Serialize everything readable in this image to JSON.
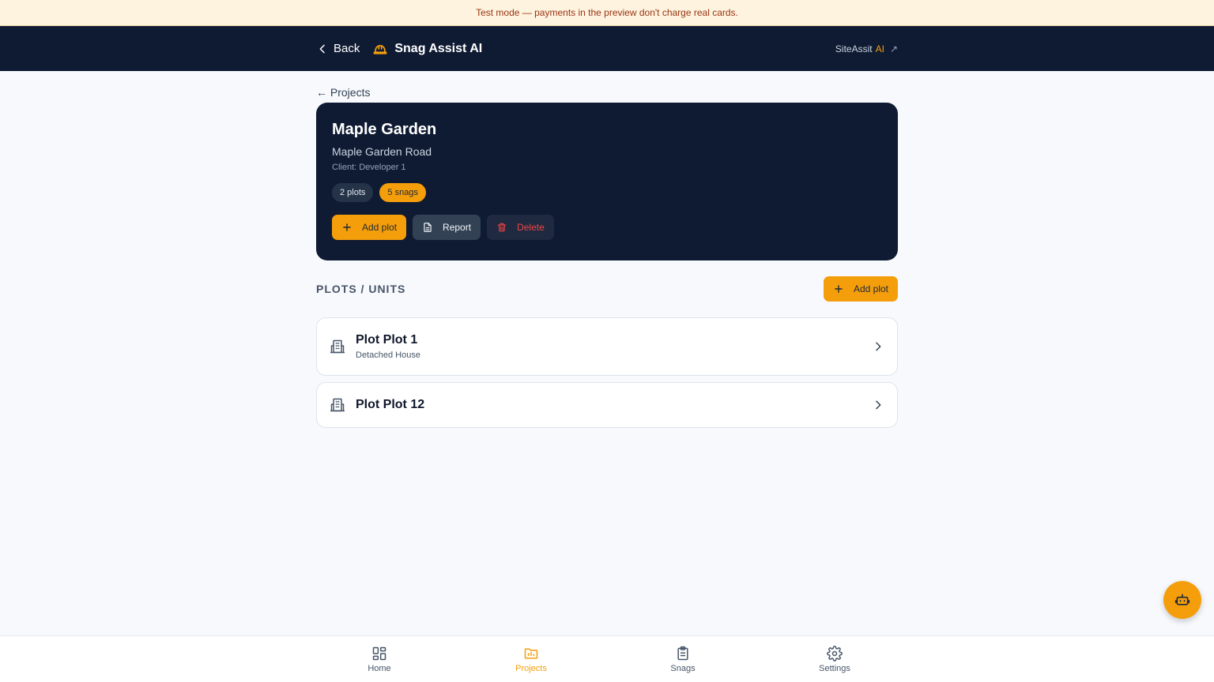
{
  "banner": {
    "text": "Test mode — payments in the preview don't charge real cards."
  },
  "topbar": {
    "back_label": "Back",
    "app_title": "Snag Assist AI",
    "site_link_prefix": "SiteAssit",
    "site_link_suffix": "AI",
    "site_link_arrow": "↗"
  },
  "breadcrumb": {
    "label": "← Projects"
  },
  "project": {
    "name": "Maple Garden",
    "address": "Maple Garden Road",
    "client": "Client: Developer 1",
    "plots_badge": "2 plots",
    "snags_badge": "5 snags",
    "actions": {
      "add_plot": "Add plot",
      "report": "Report",
      "delete": "Delete"
    }
  },
  "plots_section": {
    "title": "PLOTS / UNITS",
    "add_label": "Add plot",
    "items": [
      {
        "name": "Plot Plot 1",
        "type": "Detached House"
      },
      {
        "name": "Plot Plot 12",
        "type": ""
      }
    ]
  },
  "bottom_nav": {
    "items": [
      {
        "label": "Home",
        "icon": "grid-icon"
      },
      {
        "label": "Projects",
        "icon": "folder-icon",
        "active": true
      },
      {
        "label": "Snags",
        "icon": "clipboard-icon"
      },
      {
        "label": "Settings",
        "icon": "gear-icon"
      }
    ]
  },
  "colors": {
    "accent": "#f59e0b",
    "navy": "#0f1b33",
    "danger": "#ef4444"
  }
}
